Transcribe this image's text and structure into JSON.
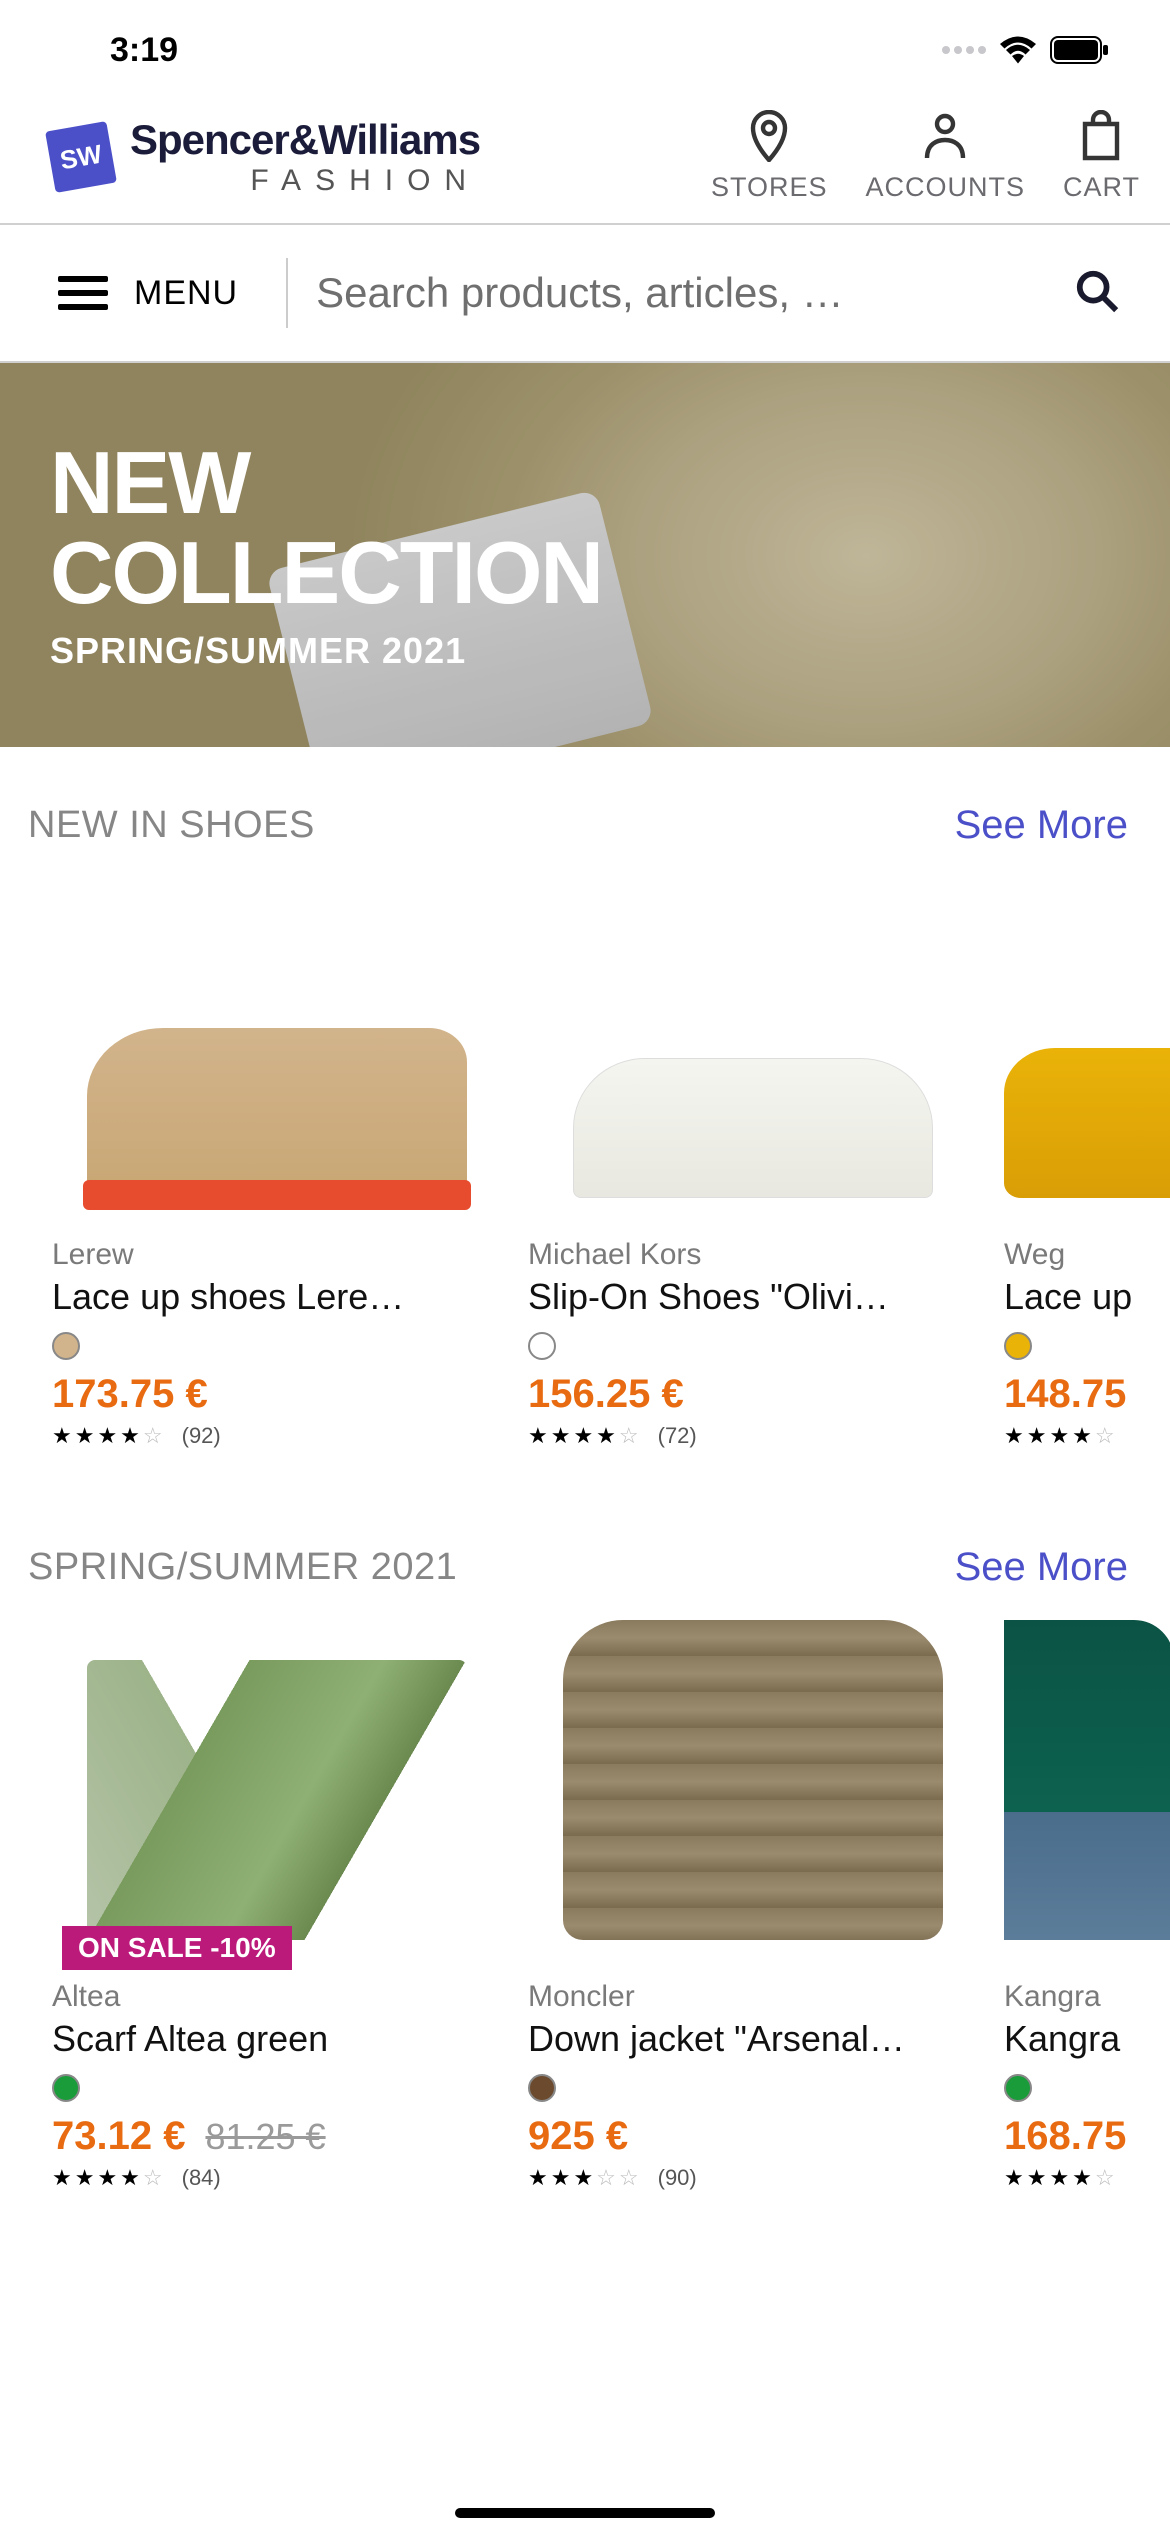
{
  "status": {
    "time": "3:19"
  },
  "brand": {
    "mark": "SW",
    "name": "Spencer&Williams",
    "sub": "FASHION"
  },
  "header_actions": {
    "stores": "STORES",
    "accounts": "ACCOUNTS",
    "cart": "CART"
  },
  "menu": {
    "label": "MENU"
  },
  "search": {
    "placeholder": "Search products, articles, …"
  },
  "hero": {
    "title_line1": "NEW",
    "title_line2": "COLLECTION",
    "subtitle": "SPRING/SUMMER 2021"
  },
  "sections": [
    {
      "title": "NEW IN SHOES",
      "see_more": "See More",
      "products": [
        {
          "brand": "Lerew",
          "name": "Lace up shoes Lere…",
          "swatch": "#d2b48c",
          "price": "173.75 €",
          "stars": 4,
          "reviews": "(92)"
        },
        {
          "brand": "Michael Kors",
          "name": "Slip-On Shoes \"Olivi…",
          "swatch": "#ffffff",
          "price": "156.25 €",
          "stars": 4,
          "reviews": "(72)"
        },
        {
          "brand": "Weg",
          "name": "Lace up",
          "swatch": "#eab308",
          "price": "148.75",
          "stars": 4,
          "reviews": ""
        }
      ]
    },
    {
      "title": "SPRING/SUMMER 2021",
      "see_more": "See More",
      "products": [
        {
          "brand": "Altea",
          "name": "Scarf Altea green",
          "swatch": "#1a9c3a",
          "price": "73.12 €",
          "price_old": "81.25 €",
          "sale_badge": "ON SALE -10%",
          "stars": 4,
          "reviews": "(84)"
        },
        {
          "brand": "Moncler",
          "name": "Down jacket \"Arsenal…",
          "swatch": "#6b4a2e",
          "price": "925 €",
          "stars": 3,
          "reviews": "(90)"
        },
        {
          "brand": "Kangra",
          "name": "Kangra",
          "swatch": "#1a9c3a",
          "price": "168.75",
          "stars": 4,
          "reviews": ""
        }
      ]
    }
  ]
}
